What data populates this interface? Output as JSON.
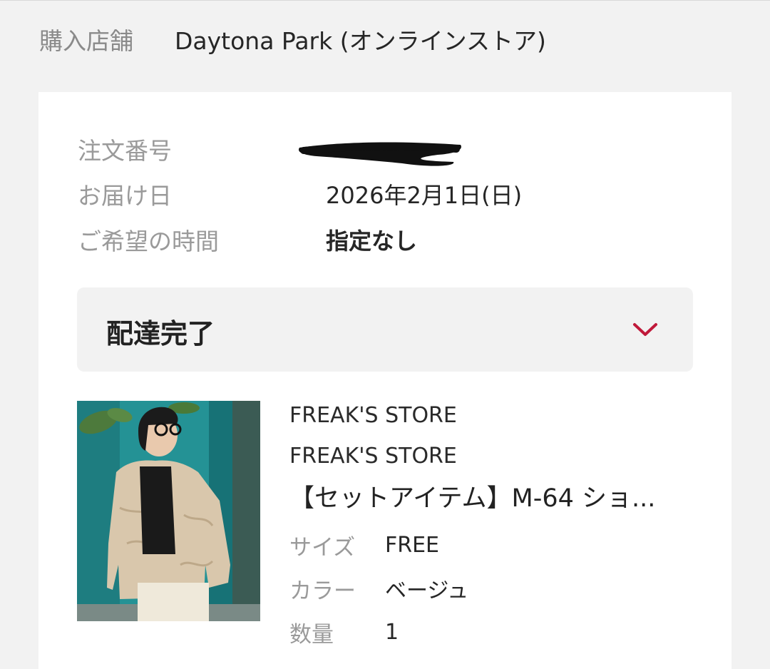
{
  "store": {
    "label": "購入店舗",
    "value": "Daytona Park (オンラインストア)"
  },
  "order": {
    "number_label": "注文番号",
    "delivery_date_label": "お届け日",
    "delivery_date_value": "2026年2月1日(日)",
    "time_label": "ご希望の時間",
    "time_value": "指定なし"
  },
  "status": {
    "label": "配達完了",
    "chevron_icon": "chevron-down-icon",
    "chevron_color": "#c0193a"
  },
  "product": {
    "brand_1": "FREAK'S STORE",
    "brand_2": "FREAK'S STORE",
    "name": "【セットアイテム】M-64 ショ...",
    "size_label": "サイズ",
    "size_value": "FREE",
    "color_label": "カラー",
    "color_value": "ベージュ",
    "quantity_label": "数量",
    "quantity_value": "1"
  }
}
